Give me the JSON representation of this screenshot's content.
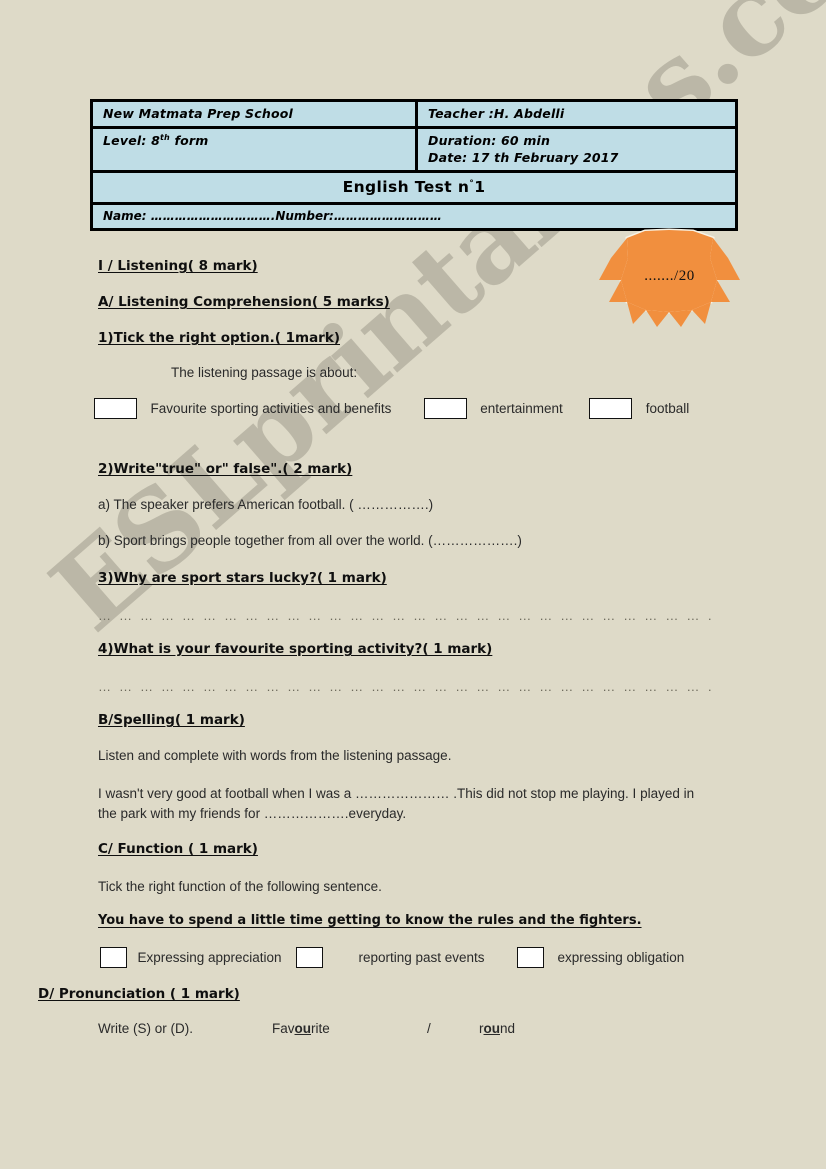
{
  "document": {
    "background_color": "#dedac8",
    "header_cell_color": "#bfdde6",
    "badge_color": "#f18f3e"
  },
  "watermark": {
    "text": "ESLprintables.com"
  },
  "header": {
    "school": "New Matmata Prep School",
    "teacher": "Teacher :H. Abdelli",
    "level_prefix": "Level: 8",
    "level_sup": "th",
    "level_suffix": " form",
    "duration": "Duration: 60 min",
    "date": "Date: 17 th February 2017",
    "title_prefix": "English Test n",
    "title_degree": "°",
    "title_number": "1",
    "name_line": "Name: ………………………….Number:………………………"
  },
  "badge": {
    "score": "......./20"
  },
  "sections": {
    "listening_heading": "I / Listening( 8 mark)",
    "comprehension_heading": "A/ Listening Comprehension( 5 marks)",
    "q1_heading": "1)Tick the right option.( 1mark)",
    "q1_prompt": "The listening passage is about:",
    "q1_options": [
      "Favourite sporting activities and benefits",
      "entertainment",
      "football"
    ],
    "q2_heading": "2)Write\"true\" or\" false\".( 2 mark)",
    "q2_items": [
      "a) The speaker prefers American football.          (          …………….)",
      "b) Sport brings people together from all over the world. (……………….)"
    ],
    "q3_heading": "3)Why  are sport stars lucky?( 1 mark)",
    "q4_heading": "4)What is your favourite sporting activity?( 1 mark)",
    "answer_dots": "… … … … … … … … … … … … … … … … … … … … … … … … … … … … … … … … …",
    "spelling_heading": "B/Spelling( 1 mark)",
    "spelling_instruction": "Listen and complete with words from the listening passage.",
    "spelling_text": "I wasn't very good at football when I was a …………………   .This did not stop me playing. I played in the park with my friends for ……………….everyday.",
    "function_heading": "C/ Function ( 1 mark)",
    "function_instruction": "Tick the right function of the following sentence.",
    "function_sentence": "You have to spend a little time getting  to know the rules and the fighters.",
    "function_options": [
      "Expressing appreciation",
      "reporting past events",
      "expressing obligation"
    ],
    "pronunciation_heading": "D/ Pronunciation ( 1 mark)",
    "pronunciation_instruction": "Write (S) or (D).",
    "pron_word1_pre": "Fav",
    "pron_word1_mid": "ou",
    "pron_word1_post": "rite",
    "pron_separator": "/",
    "pron_word2_pre": "r",
    "pron_word2_mid": "ou",
    "pron_word2_post": "nd"
  }
}
